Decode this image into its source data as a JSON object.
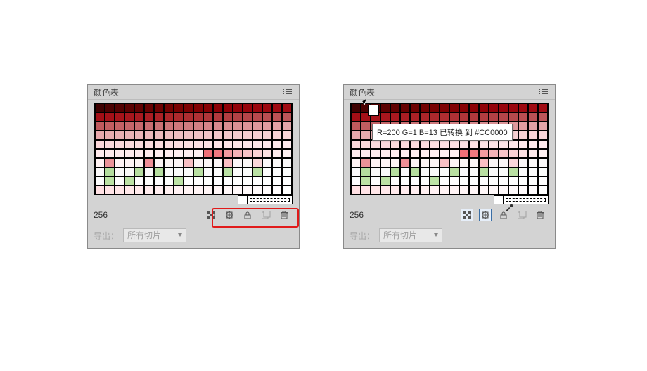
{
  "panel_title": "颜色表",
  "count": "256",
  "export_label": "导出：",
  "export_value": "所有切片",
  "tooltip": "R=200 G=1 B=13 已转换 到 #CC0000",
  "icons": {
    "map": "map-transparent-icon",
    "snap": "snap-web-icon",
    "lock": "lock-icon",
    "new": "new-swatch-icon",
    "trash": "trash-icon",
    "menu": "panel-menu-icon"
  },
  "palette_rows": [
    [
      "#3e0000",
      "#4a0000",
      "#520000",
      "#5a0000",
      "#600000",
      "#660000",
      "#6c0000",
      "#720000",
      "#780001",
      "#7d0002",
      "#820003",
      "#870004",
      "#8b0006",
      "#8f0108",
      "#93020a",
      "#97040c",
      "#9a060e",
      "#9d0810",
      "#9f0a12",
      "#a10c14"
    ],
    [
      "#a30e16",
      "#a51018",
      "#a7131a",
      "#a8161d",
      "#a91920",
      "#aa1d23",
      "#ab2126",
      "#ac2529",
      "#ad292d",
      "#ae2d31",
      "#af3135",
      "#b03539",
      "#b1393d",
      "#b23d41",
      "#b34145",
      "#b54549",
      "#b7494d",
      "#b94d51",
      "#bb5155",
      "#bd5559"
    ],
    [
      "#bf595d",
      "#c15d61",
      "#c36165",
      "#c56569",
      "#c7696d",
      "#c96d71",
      "#cb7175",
      "#cd7579",
      "#cf797d",
      "#d17d81",
      "#d38185",
      "#d58589",
      "#d7898d",
      "#d98d91",
      "#db9195",
      "#dd9599",
      "#df999d",
      "#e19da1",
      "#e3a1a5",
      "#e5a5a9"
    ],
    [
      "#e6a8ac",
      "#e7abae",
      "#e8aeb1",
      "#e9b1b4",
      "#eab4b7",
      "#ebb7ba",
      "#ecbabd",
      "#edbdc0",
      "#eebfc2",
      "#efc1c4",
      "#f0c3c6",
      "#f1c5c8",
      "#f2c7ca",
      "#f3c9cc",
      "#f4cbce",
      "#f5cdd0",
      "#f6cfd2",
      "#f7d1d4",
      "#f8d3d6",
      "#f9d5d8"
    ],
    [
      "#fad7da",
      "#fad8db",
      "#fbd9dc",
      "#fbdadd",
      "#fbdbde",
      "#fcdcdf",
      "#fcdde0",
      "#fcdee1",
      "#fddfe2",
      "#fde0e3",
      "#fde1e4",
      "#fde2e5",
      "#fee3e6",
      "#fee4e7",
      "#fee5e8",
      "#fee6e9",
      "#ffe7ea",
      "#ffe8eb",
      "#ffe9ec",
      "#ffeaed"
    ],
    [
      "#ffeaed",
      "#ffeaed",
      "#ffebee",
      "#ffebee",
      "#ffecef",
      "#ffecef",
      "#ffedf0",
      "#ffedf0",
      "#ffeef1",
      "#ffeef1",
      "#ffeff2",
      "#ee6f77",
      "#f07880",
      "#f39aa0",
      "#f6b3b8",
      "#f8c3c7",
      "#fbd2d5",
      "#fde0e2",
      "#feeaec",
      "#fff1f2"
    ],
    [
      "#fff2f3",
      "#ea9298",
      "#fff3f4",
      "#fff4f5",
      "#fef4f4",
      "#ee8e96",
      "#fdf4f5",
      "#fdf5f5",
      "#fdf5f6",
      "#f8bfc4",
      "#fcf5f6",
      "#fcf6f6",
      "#fcf6f7",
      "#fabec3",
      "#fbf6f7",
      "#fbf7f7",
      "#fad7da",
      "#fbf7f8",
      "#fbf8f8",
      "#faf8f8"
    ],
    [
      "#faf8f9",
      "#b4dd9e",
      "#faf9f9",
      "#faf9f9",
      "#b6de9f",
      "#faf9fa",
      "#b7dfa0",
      "#fafafa",
      "#fafafa",
      "#fafbfa",
      "#b9e0a2",
      "#fafafb",
      "#fbfbfb",
      "#b9e0a3",
      "#fbfbfb",
      "#fbfcfb",
      "#bae1a3",
      "#fcfcfc",
      "#fcfcfc",
      "#fcfdfc"
    ],
    [
      "#fcfcfd",
      "#bbe2a4",
      "#fdfdfd",
      "#bce2a5",
      "#fdfdfd",
      "#fdfefd",
      "#fdfdfe",
      "#fefefe",
      "#bde3a6",
      "#fefefe",
      "#fefefe",
      "#fefffe",
      "#fefeff",
      "#fefeff",
      "#ffffff",
      "#ffffff",
      "#ffffff",
      "#ffffff",
      "#ffffff",
      "#ffffff"
    ],
    [
      "#ffe0e3",
      "#ffe3e6",
      "#ffe6e8",
      "#ffe8ea",
      "#ffeaec",
      "#ffecee",
      "#ffeef0",
      "#fff0f1",
      "#fff1f3",
      "#fff3f4",
      "#fff4f5",
      "#fff5f6",
      "#fff6f7",
      "#fff7f8",
      "#fff8f9",
      "#fff9fa",
      "#fffafb",
      "#fffbfc",
      "#fffcfd",
      "#ffffff"
    ]
  ]
}
